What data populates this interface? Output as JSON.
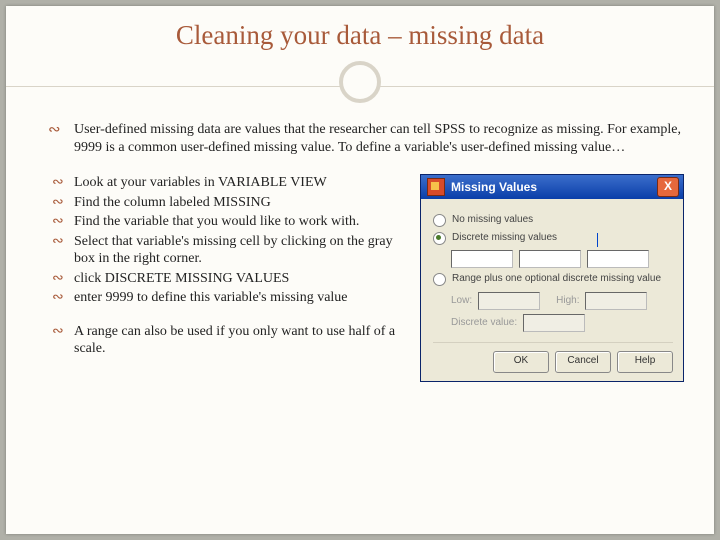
{
  "slide": {
    "title": "Cleaning your data – missing data",
    "lead": "User-defined missing data are values that the researcher can tell SPSS to recognize as missing.  For example, 9999 is a common user-defined missing value.  To define a variable's user-defined missing value…",
    "bullets": [
      "Look at your variables in VARIABLE VIEW",
      "Find the column labeled MISSING",
      "Find the variable that you would like to work with.",
      "Select that variable's missing cell by clicking on the gray box in the right corner.",
      "click DISCRETE MISSING VALUES",
      "enter 9999 to define this variable's missing value"
    ],
    "footnote": "A range can also be used if you only want to use half of a scale."
  },
  "dialog": {
    "title": "Missing Values",
    "close": "X",
    "opt_none": "No missing values",
    "opt_discrete": "Discrete missing values",
    "opt_range": "Range plus one optional discrete missing value",
    "low_label": "Low:",
    "high_label": "High:",
    "discrete_label": "Discrete value:",
    "ok": "OK",
    "cancel": "Cancel",
    "help": "Help"
  }
}
